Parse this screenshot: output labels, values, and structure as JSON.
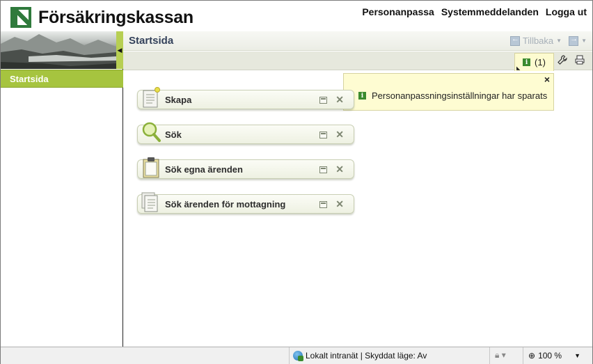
{
  "brand": {
    "name": "Försäkringskassan",
    "color": "#2f7a3c"
  },
  "topnav": {
    "personalize": "Personanpassa",
    "system_messages": "Systemmeddelanden",
    "logout": "Logga ut"
  },
  "sidebar": {
    "collapse_icon": "arrow-left-icon",
    "items": [
      {
        "label": "Startsida",
        "active": true
      }
    ],
    "active_color": "#a6c43f"
  },
  "main": {
    "title": "Startsida",
    "back_label": "Tillbaka"
  },
  "toolbar": {
    "notification_count": "(1)"
  },
  "notification": {
    "message": "Personanpassningsinställningar har sparats",
    "close": "×"
  },
  "widgets": [
    {
      "label": "Skapa",
      "icon": "create-document-icon"
    },
    {
      "label": "Sök",
      "icon": "magnifier-icon"
    },
    {
      "label": "Sök egna ärenden",
      "icon": "clipboard-icon"
    },
    {
      "label": "Sök ärenden för mottagning",
      "icon": "documents-stack-icon"
    }
  ],
  "statusbar": {
    "zone": "Lokalt intranät | Skyddat läge: Av",
    "zoom": "100 %"
  }
}
